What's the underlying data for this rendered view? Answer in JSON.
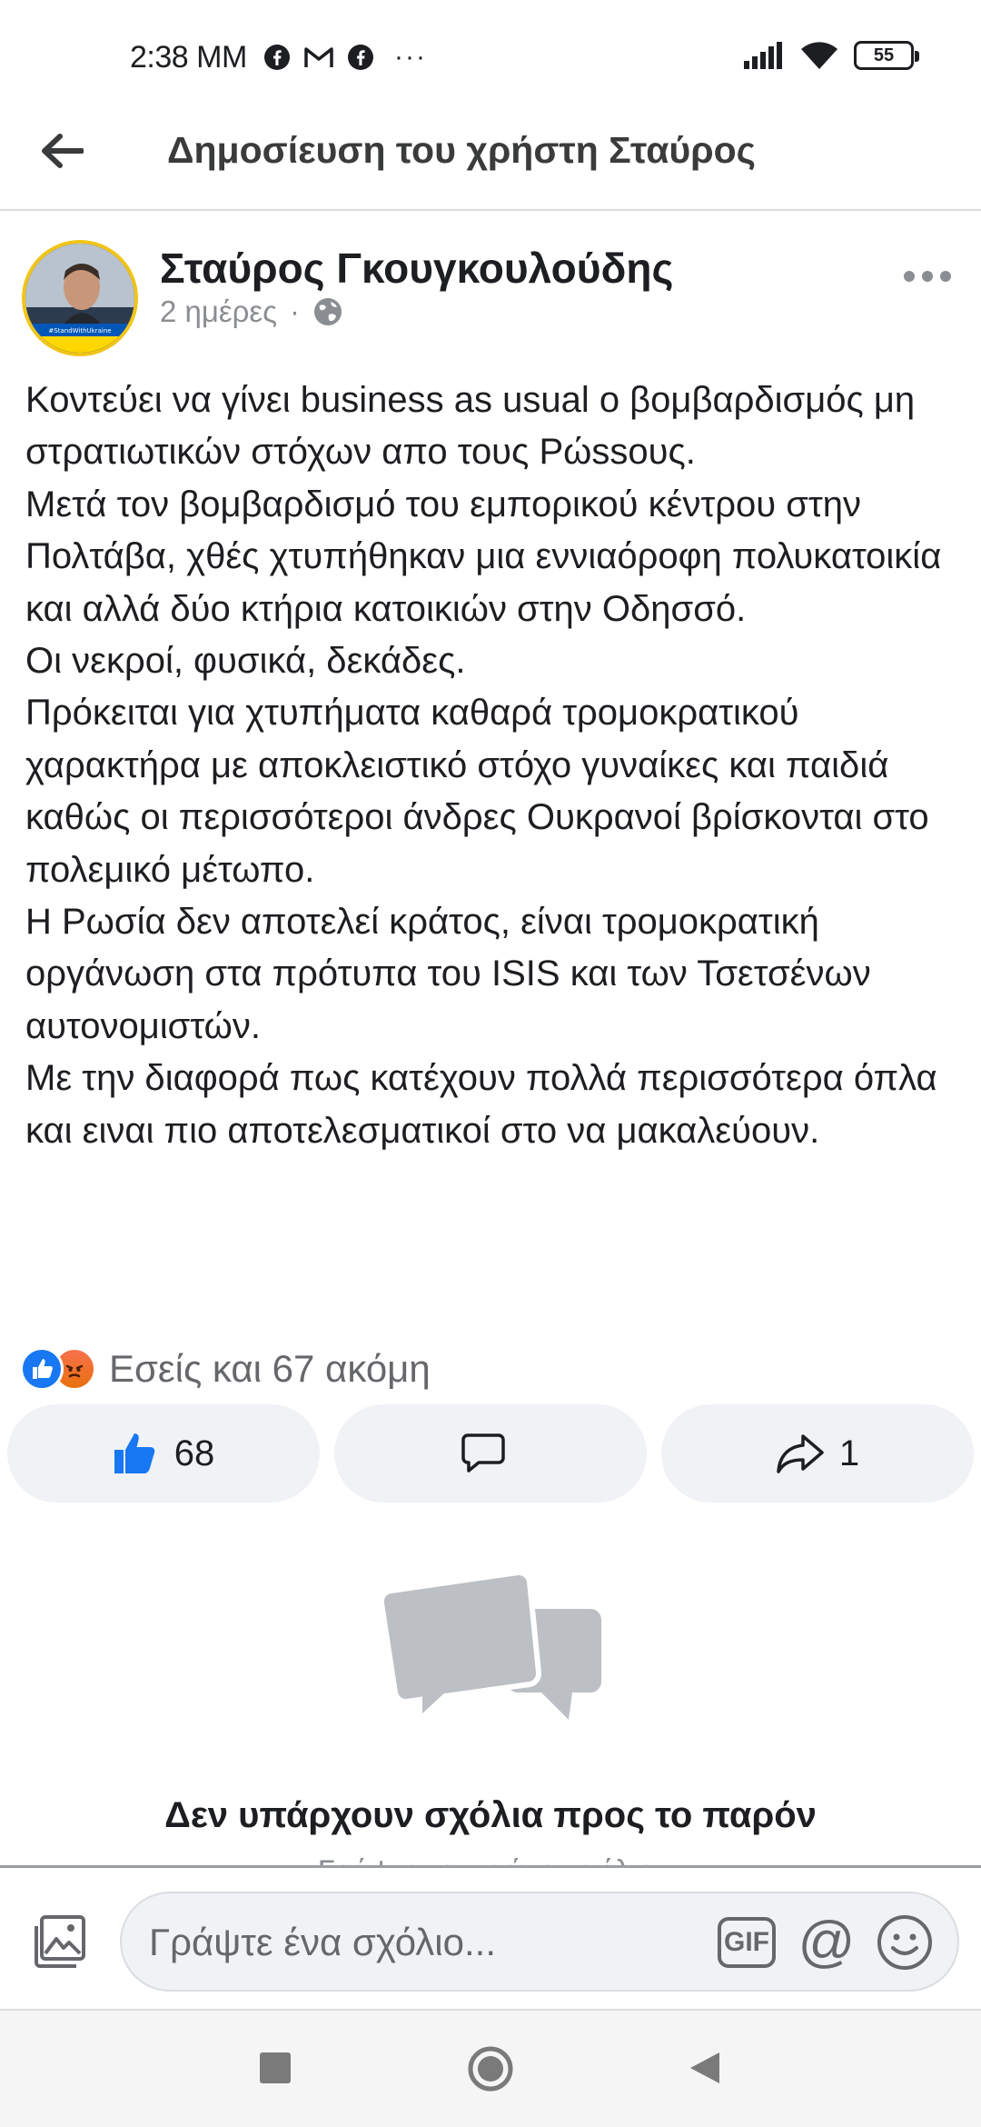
{
  "status_bar": {
    "time": "2:38 MM",
    "more": "···",
    "battery": "55",
    "icons": [
      "facebook-icon",
      "gmail-icon",
      "facebook-icon",
      "signal-icon",
      "wifi-icon",
      "battery-icon"
    ]
  },
  "header": {
    "title": "Δημοσίευση του χρήστη Σταύρος",
    "back_icon": "arrow-left-icon"
  },
  "post": {
    "author": "Σταύρος Γκουγκουλούδης",
    "avatar_badge": "#StandWithUkraine",
    "time_ago": "2 ημέρες",
    "separator": "·",
    "privacy_icon": "globe-icon",
    "text": "Κοντεύει να γίνει business as usual ο βομβαρδισμός μη στρατιωτικών στόχων απο τους Ρώssους.\nΜετά τον βομβαρδισμό του εμπορικού κέντρου στην Πολτάβα, χθές χτυπήθηκαν μια εννιαόροφη πολυκατοικία και αλλά δύο κτήρια κατοικιών στην Οδησσό.\nΟι νεκροί, φυσικά, δεκάδες.\nΠρόκειται για χτυπήματα καθαρά τρομοκρατικού χαρακτήρα με αποκλειστικό στόχο γυναίκες και παιδιά καθώς οι περισσότεροι άνδρες Ουκρανοί βρίσκονται στο πολεμικό μέτωπο.\nΗ Ρωσία δεν αποτελεί κράτος, είναι τρομοκρατική οργάνωση στα πρότυπα του ISIS και των Τσετσένων αυτονομιστών.\nΜε την διαφορά πως κατέχουν πολλά περισσότερα όπλα και ειναι πιο αποτελεσματικοί στο να μακαλεύουν."
  },
  "reactions": {
    "summary": "Εσείς και 67 ακόμη",
    "icons": [
      "like-reaction-icon",
      "angry-reaction-icon"
    ]
  },
  "actions": {
    "like_count": "68",
    "comment_count": "",
    "share_count": "1"
  },
  "comments": {
    "empty_title": "Δεν υπάρχουν σχόλια προς το παρόν",
    "empty_subtitle": "Γράψτε το πρώτο σχόλιο."
  },
  "composer": {
    "placeholder": "Γράψτε ένα σχόλιο...",
    "gif_label": "GIF",
    "mention_label": "@"
  },
  "colors": {
    "brand_blue": "#1877f2",
    "secondary_text": "#65676b",
    "button_bg": "#f0f2f5"
  }
}
